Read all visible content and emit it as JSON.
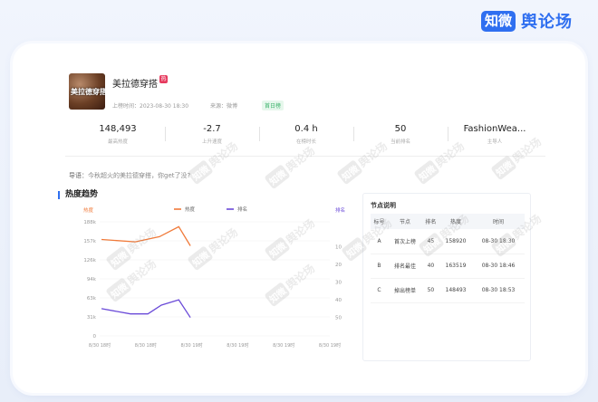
{
  "brand": {
    "badge": "知微",
    "name": "舆论场"
  },
  "article": {
    "thumb_text": "美拉德穿搭",
    "title": "美拉德穿搭",
    "publish_time": "上榜时间：2023-08-30 18:30",
    "source": "来源：微博",
    "status_tag": "首日榜"
  },
  "stats": [
    {
      "value": "148,493",
      "label": "最高热度"
    },
    {
      "value": "-2.7",
      "label": "上升速度"
    },
    {
      "value": "0.4 h",
      "label": "在榜时长"
    },
    {
      "value": "50",
      "label": "当前排名"
    },
    {
      "value": "FashionWea...",
      "label": "主导人"
    }
  ],
  "intro": {
    "prefix": "导语：",
    "text": "今秋超火的美拉德穿搭，你get了没?"
  },
  "trend": {
    "title": "热度趋势",
    "left_axis_label": "热度",
    "right_axis_label": "排名",
    "legend": [
      {
        "name": "热度",
        "color": "#f07a3a"
      },
      {
        "name": "排名",
        "color": "#6a4ad8"
      }
    ]
  },
  "chart_data": {
    "type": "line",
    "x": [
      "8/30 18时",
      "8/30 18时",
      "8/30 18时",
      "8/30 18时",
      "8/30 18时"
    ],
    "x_ticks": [
      "8/30 18时",
      "8/30 18时",
      "8/30 19时",
      "8/30 19时",
      "8/30 19时",
      "8/30 19时"
    ],
    "y_left_ticks": [
      "0",
      "31k",
      "63k",
      "94k",
      "126k",
      "157k",
      "188k"
    ],
    "y_right_ticks": [
      "10",
      "20",
      "30",
      "40",
      "50"
    ],
    "ylim_left": [
      0,
      188000
    ],
    "ylim_right": [
      0,
      60
    ],
    "series": [
      {
        "name": "热度",
        "axis": "left",
        "color": "#f07a3a",
        "x": [
          0,
          0.35,
          0.6,
          0.8,
          0.92
        ],
        "values": [
          158920,
          155000,
          163519,
          180000,
          148493
        ]
      },
      {
        "name": "排名",
        "axis": "right",
        "color": "#6a4ad8",
        "x": [
          0,
          0.3,
          0.48,
          0.62,
          0.8,
          0.92
        ],
        "values": [
          45,
          48,
          48,
          43,
          40,
          50
        ]
      }
    ]
  },
  "nodes": {
    "title": "节点说明",
    "headers": [
      "标号",
      "节点",
      "排名",
      "热度",
      "时间"
    ],
    "rows": [
      {
        "mark": "A",
        "node": "首次上榜",
        "rank": "45",
        "heat": "158920",
        "time": "08-30 18:30"
      },
      {
        "mark": "B",
        "node": "排名最佳",
        "rank": "40",
        "heat": "163519",
        "time": "08-30 18:46"
      },
      {
        "mark": "C",
        "node": "掉出榜单",
        "rank": "50",
        "heat": "148493",
        "time": "08-30 18:53"
      }
    ]
  },
  "watermark": {
    "badge": "知微",
    "text": "舆论场"
  }
}
